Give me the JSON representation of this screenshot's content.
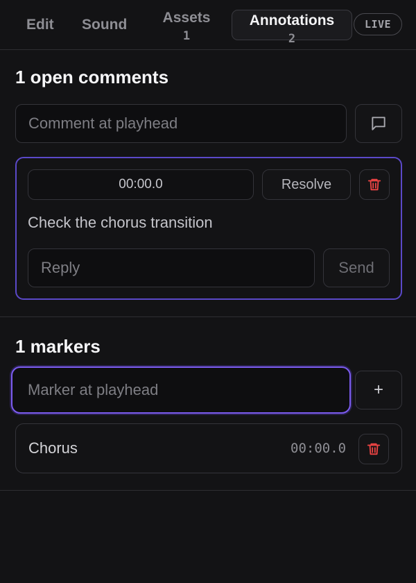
{
  "tabs": [
    {
      "label": "Edit",
      "count": ""
    },
    {
      "label": "Sound",
      "count": ""
    },
    {
      "label": "Assets",
      "count": "1"
    },
    {
      "label": "Annotations",
      "count": "2"
    }
  ],
  "live_badge": "LIVE",
  "comments": {
    "title": "1 open comments",
    "input_placeholder": "Comment at playhead",
    "items": [
      {
        "timestamp": "00:00.0",
        "resolve_label": "Resolve",
        "text": "Check the chorus transition",
        "reply_placeholder": "Reply",
        "send_label": "Send"
      }
    ]
  },
  "markers": {
    "title": "1 markers",
    "input_placeholder": "Marker at playhead",
    "add_label": "+",
    "items": [
      {
        "name": "Chorus",
        "time": "00:00.0"
      }
    ]
  },
  "colors": {
    "accent": "#7c5cf0",
    "card_border": "#5b49c9",
    "danger": "#ef4444",
    "background": "#131315"
  },
  "icons": {
    "comment_button": "message-square-icon",
    "delete": "trash-icon"
  }
}
